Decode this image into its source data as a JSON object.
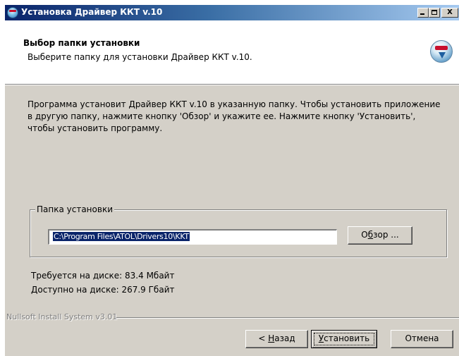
{
  "window": {
    "title": "Установка Драйвер ККТ v.10",
    "minimize_label": "_",
    "maximize_label": "□",
    "close_label": "X"
  },
  "header": {
    "title": "Выбор папки установки",
    "subtitle": "Выберите папку для установки Драйвер ККТ v.10.",
    "logo_icon": "installer-disc-icon"
  },
  "intro": {
    "text": "Программа установит Драйвер ККТ v.10 в указанную папку. Чтобы установить приложение в другую папку, нажмите кнопку 'Обзор' и укажите ее. Нажмите кнопку 'Установить', чтобы установить программу."
  },
  "install_folder": {
    "group_label": "Папка установки",
    "path_value": "C:\\Program Files\\ATOL\\Drivers10\\KKT",
    "browse_prefix": "О",
    "browse_accel": "б",
    "browse_suffix": "зор ..."
  },
  "disk": {
    "required": "Требуется на диске: 83.4 Мбайт",
    "available": "Доступно на диске: 267.9 Гбайт"
  },
  "footer": {
    "branding": "Nullsoft Install System v3.01",
    "back_prefix": "< ",
    "back_accel": "Н",
    "back_suffix": "азад",
    "install_accel": "У",
    "install_suffix": "становить",
    "cancel_label": "Отмена"
  },
  "colors": {
    "titlebar_start": "#0a246a",
    "titlebar_end": "#a6caf0",
    "dialog_bg": "#d4d0c8",
    "selection_bg": "#0a246a"
  }
}
